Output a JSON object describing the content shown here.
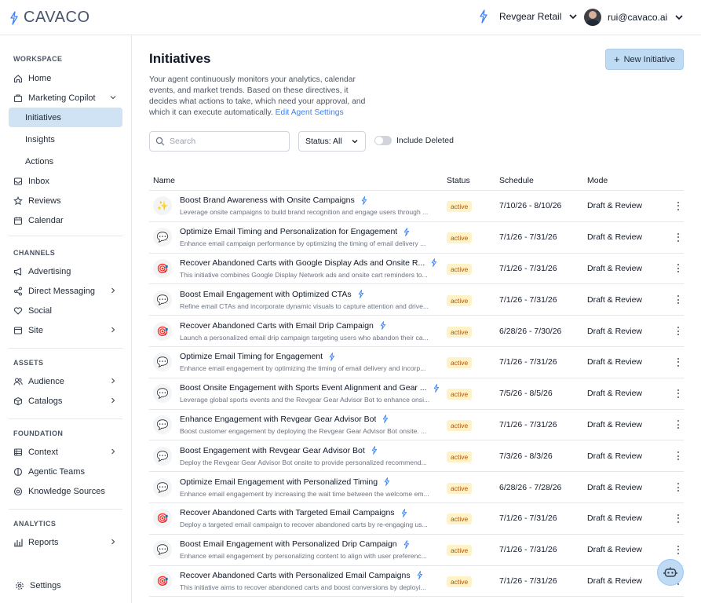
{
  "app": {
    "logo_text": "CAVACO"
  },
  "header": {
    "org_name": "Revgear Retail",
    "user_email": "rui@cavaco.ai"
  },
  "sidebar": {
    "workspace_title": "WORKSPACE",
    "home": "Home",
    "marketing_copilot": "Marketing Copilot",
    "initiatives": "Initiatives",
    "insights": "Insights",
    "actions": "Actions",
    "inbox": "Inbox",
    "reviews": "Reviews",
    "calendar": "Calendar",
    "channels_title": "CHANNELS",
    "advertising": "Advertising",
    "direct_messaging": "Direct Messaging",
    "social": "Social",
    "site": "Site",
    "assets_title": "ASSETS",
    "audience": "Audience",
    "catalogs": "Catalogs",
    "foundation_title": "FOUNDATION",
    "context": "Context",
    "agentic_teams": "Agentic Teams",
    "knowledge_sources": "Knowledge Sources",
    "analytics_title": "ANALYTICS",
    "reports": "Reports",
    "settings": "Settings"
  },
  "main": {
    "title": "Initiatives",
    "description": "Your agent continuously monitors your analytics, calendar events, and market trends. Based on these directives, it decides what actions to take, which need your approval, and which it can execute automatically.",
    "edit_link": "Edit Agent Settings",
    "new_button": "New Initiative",
    "search_placeholder": "Search",
    "status_filter": "Status: All",
    "include_deleted": "Include Deleted"
  },
  "table": {
    "headers": {
      "name": "Name",
      "status": "Status",
      "schedule": "Schedule",
      "mode": "Mode"
    },
    "rows": [
      {
        "icon": "✨",
        "icon_name": "sparkles-icon",
        "title": "Boost Brand Awareness with Onsite Campaigns",
        "desc": "Leverage onsite campaigns to build brand recognition and engage users through ...",
        "status": "active",
        "schedule": "7/10/26 - 8/10/26",
        "mode": "Draft & Review"
      },
      {
        "icon": "💬",
        "icon_name": "speech-bubble-icon",
        "title": "Optimize Email Timing and Personalization for Engagement",
        "desc": "Enhance email campaign performance by optimizing the timing of email delivery ...",
        "status": "active",
        "schedule": "7/1/26 - 7/31/26",
        "mode": "Draft & Review"
      },
      {
        "icon": "🎯",
        "icon_name": "target-icon",
        "title": "Recover Abandoned Carts with Google Display Ads and Onsite R...",
        "desc": "This initiative combines Google Display Network ads and onsite cart reminders to...",
        "status": "active",
        "schedule": "7/1/26 - 7/31/26",
        "mode": "Draft & Review"
      },
      {
        "icon": "💬",
        "icon_name": "speech-bubble-icon",
        "title": "Boost Email Engagement with Optimized CTAs",
        "desc": "Refine email CTAs and incorporate dynamic visuals to capture attention and drive...",
        "status": "active",
        "schedule": "7/1/26 - 7/31/26",
        "mode": "Draft & Review"
      },
      {
        "icon": "🎯",
        "icon_name": "target-icon",
        "title": "Recover Abandoned Carts with Email Drip Campaign",
        "desc": "Launch a personalized email drip campaign targeting users who abandon their ca...",
        "status": "active",
        "schedule": "6/28/26 - 7/30/26",
        "mode": "Draft & Review"
      },
      {
        "icon": "💬",
        "icon_name": "speech-bubble-icon",
        "title": "Optimize Email Timing for Engagement",
        "desc": "Enhance email engagement by optimizing the timing of email delivery and incorp...",
        "status": "active",
        "schedule": "7/1/26 - 7/31/26",
        "mode": "Draft & Review"
      },
      {
        "icon": "💬",
        "icon_name": "speech-bubble-icon",
        "title": "Boost Onsite Engagement with Sports Event Alignment and Gear ...",
        "desc": "Leverage global sports events and the Revgear Gear Advisor Bot to enhance onsi...",
        "status": "active",
        "schedule": "7/5/26 - 8/5/26",
        "mode": "Draft & Review"
      },
      {
        "icon": "💬",
        "icon_name": "speech-bubble-icon",
        "title": "Enhance Engagement with Revgear Gear Advisor Bot",
        "desc": "Boost customer engagement by deploying the Revgear Gear Advisor Bot onsite. ...",
        "status": "active",
        "schedule": "7/1/26 - 7/31/26",
        "mode": "Draft & Review"
      },
      {
        "icon": "💬",
        "icon_name": "speech-bubble-icon",
        "title": "Boost Engagement with Revgear Gear Advisor Bot",
        "desc": "Deploy the Revgear Gear Advisor Bot onsite to provide personalized recommend...",
        "status": "active",
        "schedule": "7/3/26 - 8/3/26",
        "mode": "Draft & Review"
      },
      {
        "icon": "💬",
        "icon_name": "speech-bubble-icon",
        "title": "Optimize Email Engagement with Personalized Timing",
        "desc": "Enhance email engagement by increasing the wait time between the welcome em...",
        "status": "active",
        "schedule": "6/28/26 - 7/28/26",
        "mode": "Draft & Review"
      },
      {
        "icon": "🎯",
        "icon_name": "target-icon",
        "title": "Recover Abandoned Carts with Targeted Email Campaigns",
        "desc": "Deploy a targeted email campaign to recover abandoned carts by re-engaging us...",
        "status": "active",
        "schedule": "7/1/26 - 7/31/26",
        "mode": "Draft & Review"
      },
      {
        "icon": "💬",
        "icon_name": "speech-bubble-icon",
        "title": "Boost Email Engagement with Personalized Drip Campaign",
        "desc": "Enhance email engagement by personalizing content to align with user preferenc...",
        "status": "active",
        "schedule": "7/1/26 - 7/31/26",
        "mode": "Draft & Review"
      },
      {
        "icon": "🎯",
        "icon_name": "target-icon",
        "title": "Recover Abandoned Carts with Personalized Email Campaigns",
        "desc": "This initiative aims to recover abandoned carts and boost conversions by deployi...",
        "status": "active",
        "schedule": "7/1/26 - 7/31/26",
        "mode": "Draft & Review"
      }
    ]
  },
  "colors": {
    "accent": "#3b82f6",
    "active_nav": "#cfe3f5",
    "badge_bg": "#fef3c7",
    "badge_text": "#b45309"
  }
}
